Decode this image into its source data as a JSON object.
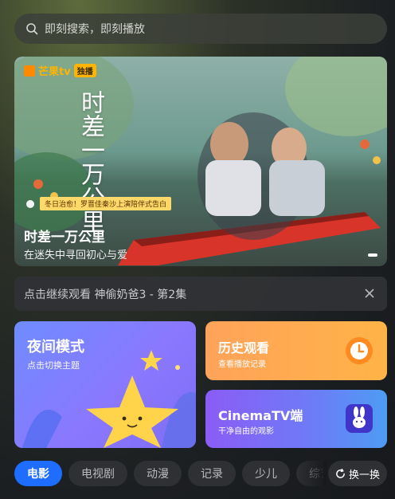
{
  "search": {
    "placeholder": "即刻搜索，即刻播放"
  },
  "banner": {
    "brand": "芒果tv",
    "brand_tag": "独播",
    "vertical_title": "时差一万公里",
    "ribbon": "冬日治愈！罗晋佳秦沙上演陪伴式告白",
    "title": "时差一万公里",
    "subtitle": "在迷失中寻回初心与爱"
  },
  "continue_watch": {
    "text": "点击继续观看 神偷奶爸3 - 第2集"
  },
  "cards": {
    "night_mode": {
      "title": "夜间模式",
      "subtitle": "点击切换主题"
    },
    "history": {
      "title": "历史观看",
      "subtitle": "查看播放记录"
    },
    "cinema": {
      "title": "CinemaTV端",
      "subtitle": "干净自由的观影"
    }
  },
  "tabs": [
    "电影",
    "电视剧",
    "动漫",
    "记录",
    "少儿",
    "综艺"
  ],
  "swap_label": "换一换",
  "colors": {
    "accent": "#1f6dff",
    "history": "#ffa35a",
    "night": "#8a78ff",
    "cinema": "#6d7cf7"
  }
}
